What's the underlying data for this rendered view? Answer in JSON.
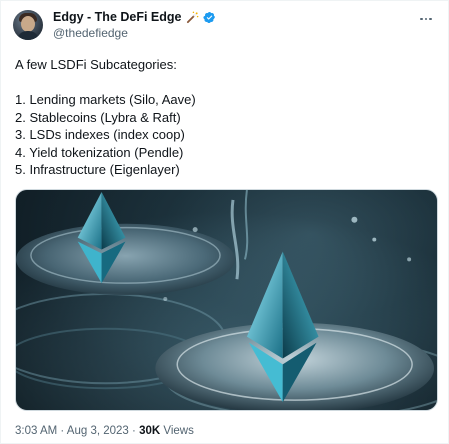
{
  "author": {
    "display_name": "Edgy - The DeFi Edge",
    "handle": "@thedefiedge",
    "name_emoji_icon": "magic-wand-icon",
    "verified_icon": "verified-badge-icon"
  },
  "tweet": {
    "intro": "A few LSDFi Subcategories:",
    "items": [
      "1. Lending markets (Silo, Aave)",
      "2. Stablecoins (Lybra & Raft)",
      "3. LSDs indexes (index coop)",
      "4. Yield tokenization (Pendle)",
      "5. Infrastructure (Eigenlayer)"
    ],
    "media_icon": "ethereum-crystal-illustration"
  },
  "meta": {
    "time": "3:03 AM",
    "separator": " · ",
    "date": "Aug 3, 2023",
    "separator2": " · ",
    "views_count": "30K",
    "views_label": " Views"
  },
  "colors": {
    "verified": "#1d9bf0",
    "secondary_text": "#536471",
    "primary_text": "#0f1419"
  }
}
